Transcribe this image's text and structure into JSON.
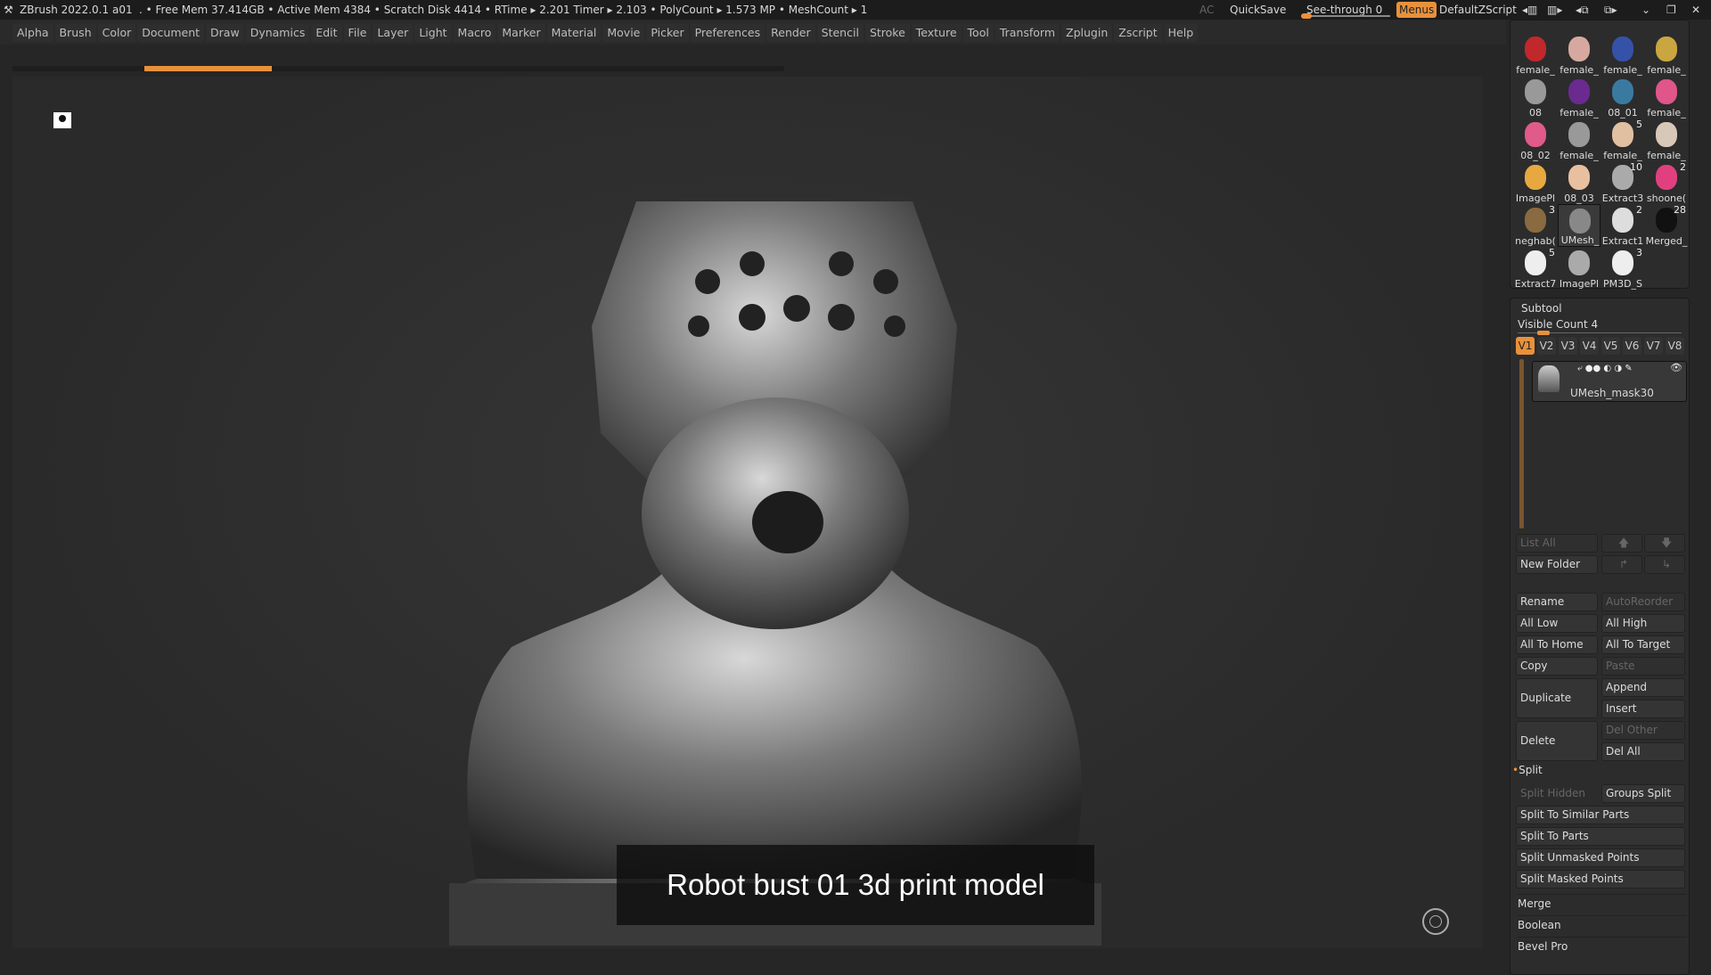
{
  "titlebar": {
    "app": "ZBrush 2022.0.1",
    "doc": "a01",
    "stats": ". • Free Mem 37.414GB • Active Mem 4384 • Scratch Disk 4414 •  RTime ▸ 2.201 Timer ▸ 2.103 • PolyCount ▸ 1.573 MP  • MeshCount ▸ 1",
    "ac": "AC",
    "quicksave": "QuickSave",
    "seethrough": "See-through  0",
    "seethrough_value": 0,
    "menus": "Menus",
    "script": "DefaultZScript"
  },
  "menus": [
    "Alpha",
    "Brush",
    "Color",
    "Document",
    "Draw",
    "Dynamics",
    "Edit",
    "File",
    "Layer",
    "Light",
    "Macro",
    "Marker",
    "Material",
    "Movie",
    "Picker",
    "Preferences",
    "Render",
    "Stencil",
    "Stroke",
    "Texture",
    "Tool",
    "Transform",
    "Zplugin",
    "Zscript",
    "Help"
  ],
  "caption": "Robot bust 01 3d print model",
  "colors": {
    "accent": "#e8913b",
    "bg": "#262626"
  },
  "tools": [
    {
      "label": "female_",
      "color": "#c0282c"
    },
    {
      "label": "female_",
      "color": "#d6a8a0"
    },
    {
      "label": "female_",
      "color": "#3552a8"
    },
    {
      "label": "female_",
      "color": "#c9a640"
    },
    {
      "label": "08",
      "color": "#999"
    },
    {
      "label": "female_",
      "color": "#6a2a90"
    },
    {
      "label": "08_01",
      "color": "#3a7aa0"
    },
    {
      "label": "female_",
      "color": "#e0558a"
    },
    {
      "label": "08_02",
      "color": "#e05a8a"
    },
    {
      "label": "female_",
      "color": "#999"
    },
    {
      "label": "female_",
      "color": "#e0c0a0",
      "badge": "5"
    },
    {
      "label": "female_",
      "color": "#d8c8b8"
    },
    {
      "label": "ImagePl",
      "color": "#e8a840"
    },
    {
      "label": "08_03",
      "color": "#e8c0a0"
    },
    {
      "label": "Extract3",
      "color": "#aaa",
      "badge": "10"
    },
    {
      "label": "shoone(",
      "color": "#e04080",
      "badge": "2"
    },
    {
      "label": "neghab(",
      "color": "#8a6a40",
      "badge": "3"
    },
    {
      "label": "UMesh_",
      "color": "#888"
    },
    {
      "label": "Extract1",
      "color": "#ddd",
      "badge": "2"
    },
    {
      "label": "Merged_",
      "color": "#111",
      "badge": "28"
    },
    {
      "label": "Extract7",
      "color": "#eee",
      "badge": "5"
    },
    {
      "label": "ImagePl",
      "color": "#aaa"
    },
    {
      "label": "PM3D_S",
      "color": "#eee",
      "badge": "3"
    }
  ],
  "subtool": {
    "title": "Subtool",
    "visible_count": "Visible Count 4",
    "visible_value": 4,
    "vtabs": [
      "V1",
      "V2",
      "V3",
      "V4",
      "V5",
      "V6",
      "V7",
      "V8"
    ],
    "active_vtab": "V1",
    "item": "UMesh_mask30",
    "list_all": "List All",
    "new_folder": "New Folder",
    "rename": "Rename",
    "autoreorder": "AutoReorder",
    "all_low": "All Low",
    "all_high": "All High",
    "all_home": "All To Home",
    "all_target": "All To Target",
    "copy": "Copy",
    "paste": "Paste",
    "duplicate": "Duplicate",
    "append": "Append",
    "insert": "Insert",
    "delete": "Delete",
    "del_other": "Del Other",
    "del_all": "Del All",
    "split": "Split",
    "split_hidden": "Split Hidden",
    "groups_split": "Groups Split",
    "split_similar": "Split To Similar Parts",
    "split_parts": "Split To Parts",
    "split_unmasked": "Split Unmasked Points",
    "split_masked": "Split Masked Points",
    "merge": "Merge",
    "boolean": "Boolean",
    "bevel": "Bevel Pro"
  }
}
